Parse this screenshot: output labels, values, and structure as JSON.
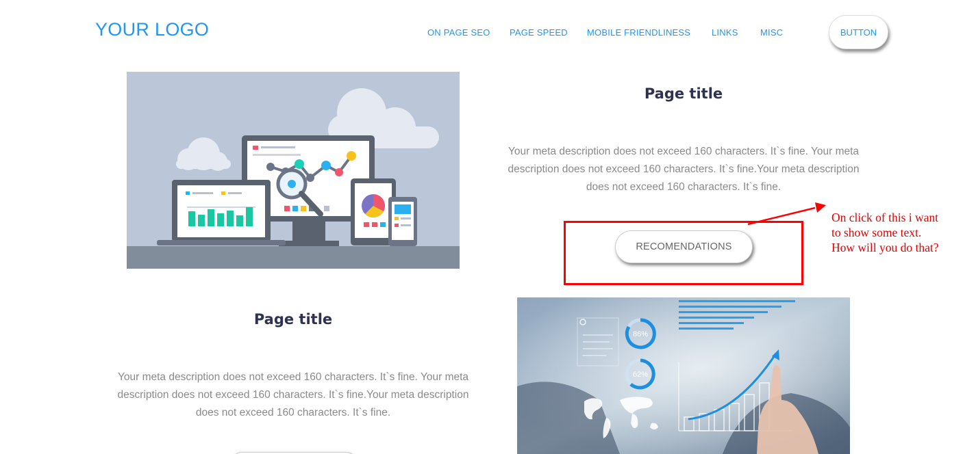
{
  "header": {
    "logo": "YOUR LOGO",
    "nav": [
      {
        "label": "ON PAGE SEO"
      },
      {
        "label": "PAGE SPEED"
      },
      {
        "label": "MOBILE FRIENDLINESS"
      },
      {
        "label": "LINKS"
      },
      {
        "label": "MISC"
      }
    ],
    "button_label": "BUTTON"
  },
  "section1": {
    "title": "Page title",
    "description": "Your meta description does not exceed 160 characters. It`s fine. Your meta description does not exceed 160 characters. It`s fine.Your meta description does not exceed 160 characters. It`s fine.",
    "button_label": "RECOMENDATIONS"
  },
  "section2": {
    "title": "Page title",
    "description": "Your meta description does not exceed 160 characters. It`s fine. Your meta description does not exceed 160 characters. It`s fine.Your meta description does not exceed 160 characters. It`s fine."
  },
  "hero_image_2": {
    "ring_labels": [
      "86%",
      "62%"
    ]
  },
  "annotation": {
    "lines": [
      "On click of this i want",
      "to show some text.",
      "How will you do that?"
    ],
    "color": "#ff0000"
  },
  "colors": {
    "accent": "#2196f3",
    "title": "#2e3150",
    "text": "#8a8a8a"
  }
}
